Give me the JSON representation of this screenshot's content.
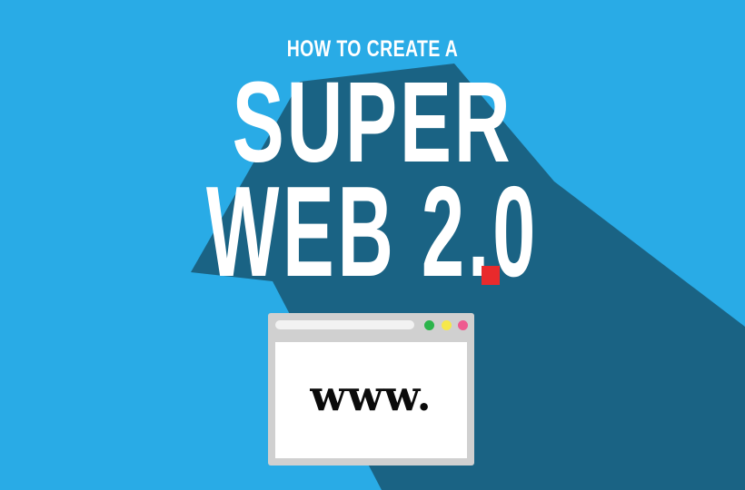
{
  "headline": {
    "kicker": "HOW TO CREATE A",
    "line1": "SUPER",
    "line2": "WEB 2.0"
  },
  "browser": {
    "address_text": "www."
  },
  "colors": {
    "background": "#29ABE6",
    "shadow": "#1A6384",
    "text": "#FFFFFF",
    "accent_dot": "#E92A2C",
    "window_frame": "#D0D0D0",
    "light_green": "#2BB44B",
    "light_yellow": "#F6E84B",
    "light_pink": "#EE5A8F"
  }
}
